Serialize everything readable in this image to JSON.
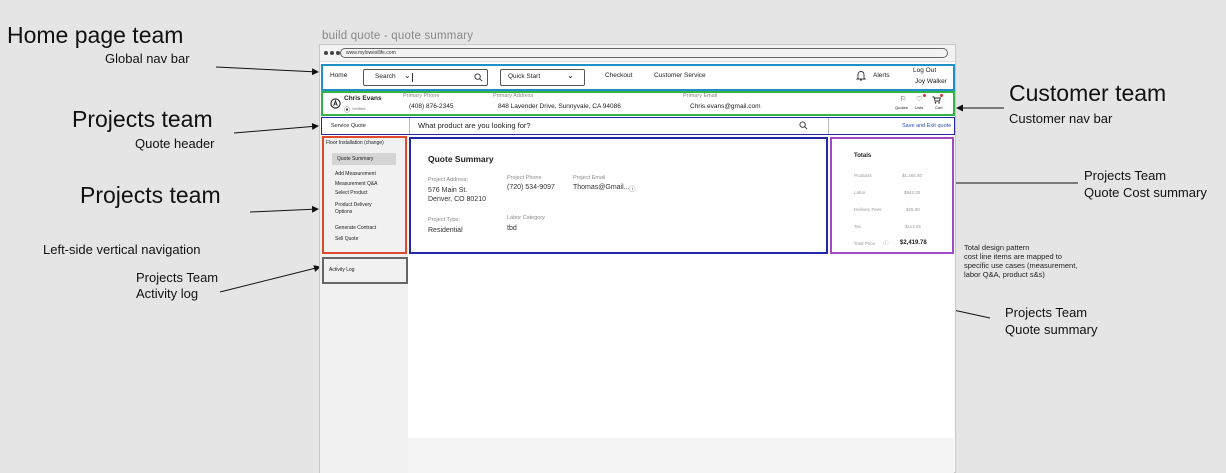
{
  "annotations": {
    "home": {
      "title": "Home page team",
      "subtitle": "Global nav bar"
    },
    "projects_header": {
      "title": "Projects team",
      "subtitle": "Quote header"
    },
    "projects_left": {
      "title": "Projects team",
      "subtitle": "Left-side vertical navigation"
    },
    "activity": {
      "title": "Projects Team",
      "subtitle": "Activity log"
    },
    "customer": {
      "title": "Customer team",
      "subtitle": "Customer nav bar"
    },
    "cost": {
      "title": "Projects Team",
      "subtitle": "Quote Cost summary"
    },
    "quote_summary": {
      "title": "Projects Team",
      "subtitle": "Quote summary"
    },
    "note": "Total design pattern\ncost line items are mapped to specific use cases (measurement, labor Q&A, product s&s)"
  },
  "wireframe": {
    "title": "build quote - quote summary",
    "url": "www.mylowesllife.com",
    "global_nav": {
      "home": "Home",
      "search": "Search",
      "quick_start": "Quick Start",
      "checkout": "Checkout",
      "customer_service": "Customer Service",
      "alerts": "Alerts",
      "logout": "Log Out",
      "user": "Joy Walker"
    },
    "customer_nav": {
      "name": "Chris Evans",
      "verified": "Verified",
      "phone_label": "Primary Phone",
      "phone": "(408) 876-2345",
      "address_label": "Primary Address",
      "address": "848 Lavender Drive, Sunnyvale, CA 94086",
      "email_label": "Primary Email",
      "email": "Chris.evans@gmail.com",
      "quotes": "Quotes",
      "lists": "Lists",
      "cart": "Cart"
    },
    "quote_header": {
      "label": "Service Quote",
      "search_placeholder": "What product are you looking for?",
      "save_exit": "Save and Exit quote"
    },
    "left_nav": {
      "heading": "Floor Installation (change)",
      "items": [
        "Quote Summary",
        "Add Measurement",
        "Measurement Q&A",
        "Select Product",
        "Product Delivery Options",
        "Generate Contract",
        "Sell Quote"
      ],
      "activity_log": "Activity Log"
    },
    "quote_summary": {
      "title": "Quote Summary",
      "address_label": "Project Address:",
      "address_line1": "576 Main St.",
      "address_line2": "Denver, CO 80210",
      "phone_label": "Project Phone",
      "phone": "(720) 534-9097",
      "email_label": "Project Email",
      "email": "Thomas@Gmail...",
      "type_label": "Project Type:",
      "type": "Residential",
      "labor_label": "Labor Category",
      "labor": "tbd"
    },
    "totals": {
      "title": "Totals",
      "rows": [
        {
          "label": "Products",
          "value": "$1,465.80"
        },
        {
          "label": "Labor",
          "value": "$942.20"
        },
        {
          "label": "Delivery Fees",
          "value": "$25.00"
        },
        {
          "label": "Tax",
          "value": "$113.25"
        }
      ],
      "total_label": "Total Price",
      "total_value": "$2,419.78"
    }
  }
}
